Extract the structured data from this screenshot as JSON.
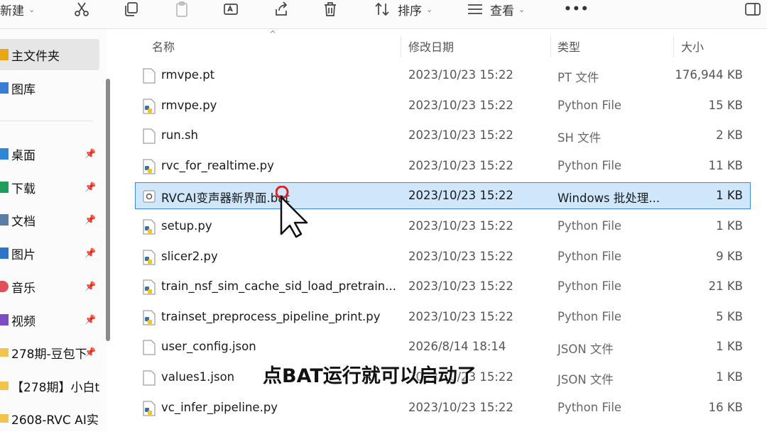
{
  "toolbar": {
    "new_label": "新建",
    "sort_label": "排序",
    "view_label": "查看",
    "more_label": "•••"
  },
  "sidebar": {
    "items": [
      {
        "label": "主文件夹",
        "icon": "home-icon",
        "pinned": false
      },
      {
        "label": "图库",
        "icon": "gallery-icon",
        "pinned": false
      },
      {
        "label": "桌面",
        "icon": "desktop-icon",
        "pinned": true
      },
      {
        "label": "下载",
        "icon": "download-icon",
        "pinned": true
      },
      {
        "label": "文档",
        "icon": "documents-icon",
        "pinned": true
      },
      {
        "label": "图片",
        "icon": "pictures-icon",
        "pinned": true
      },
      {
        "label": "音乐",
        "icon": "music-icon",
        "pinned": true
      },
      {
        "label": "视频",
        "icon": "videos-icon",
        "pinned": true
      },
      {
        "label": "278期-豆包下",
        "icon": "folder-icon",
        "pinned": true
      },
      {
        "label": "【278期】小白t",
        "icon": "folder-icon",
        "pinned": false
      },
      {
        "label": "2608-RVC AI实",
        "icon": "folder-icon",
        "pinned": false
      }
    ],
    "pin_glyph": "📌"
  },
  "columns": {
    "name": "名称",
    "date": "修改日期",
    "type": "类型",
    "size": "大小"
  },
  "files": [
    {
      "name": "rmvpe.pt",
      "date": "2023/10/23 15:22",
      "type": "PT 文件",
      "size": "176,944 KB",
      "icon": "file-icon"
    },
    {
      "name": "rmvpe.py",
      "date": "2023/10/23 15:22",
      "type": "Python File",
      "size": "15 KB",
      "icon": "python-file-icon"
    },
    {
      "name": "run.sh",
      "date": "2023/10/23 15:22",
      "type": "SH 文件",
      "size": "2 KB",
      "icon": "file-icon"
    },
    {
      "name": "rvc_for_realtime.py",
      "date": "2023/10/23 15:22",
      "type": "Python File",
      "size": "11 KB",
      "icon": "python-file-icon"
    },
    {
      "name": "RVCAI变声器新界面.bat",
      "date": "2023/10/23 15:22",
      "type": "Windows 批处理...",
      "size": "1 KB",
      "icon": "batch-file-icon",
      "selected": true
    },
    {
      "name": "setup.py",
      "date": "2023/10/23 15:22",
      "type": "Python File",
      "size": "1 KB",
      "icon": "python-file-icon"
    },
    {
      "name": "slicer2.py",
      "date": "2023/10/23 15:22",
      "type": "Python File",
      "size": "9 KB",
      "icon": "python-file-icon"
    },
    {
      "name": "train_nsf_sim_cache_sid_load_pretrain...",
      "date": "2023/10/23 15:22",
      "type": "Python File",
      "size": "21 KB",
      "icon": "python-file-icon"
    },
    {
      "name": "trainset_preprocess_pipeline_print.py",
      "date": "2023/10/23 15:22",
      "type": "Python File",
      "size": "5 KB",
      "icon": "python-file-icon"
    },
    {
      "name": "user_config.json",
      "date": "2026/8/14 18:14",
      "type": "JSON 文件",
      "size": "1 KB",
      "icon": "file-icon"
    },
    {
      "name": "values1.json",
      "date": "2023/10/23 15:22",
      "type": "JSON 文件",
      "size": "1 KB",
      "icon": "file-icon"
    },
    {
      "name": "vc_infer_pipeline.py",
      "date": "2023/10/23 15:22",
      "type": "Python File",
      "size": "16 KB",
      "icon": "python-file-icon"
    }
  ],
  "caption": "点BAT运行就可以启动了",
  "colors": {
    "selection": "#cfe6fb",
    "selection_border": "#3b8ad8",
    "python_blue": "#3572a5",
    "python_yellow": "#f5c518"
  }
}
